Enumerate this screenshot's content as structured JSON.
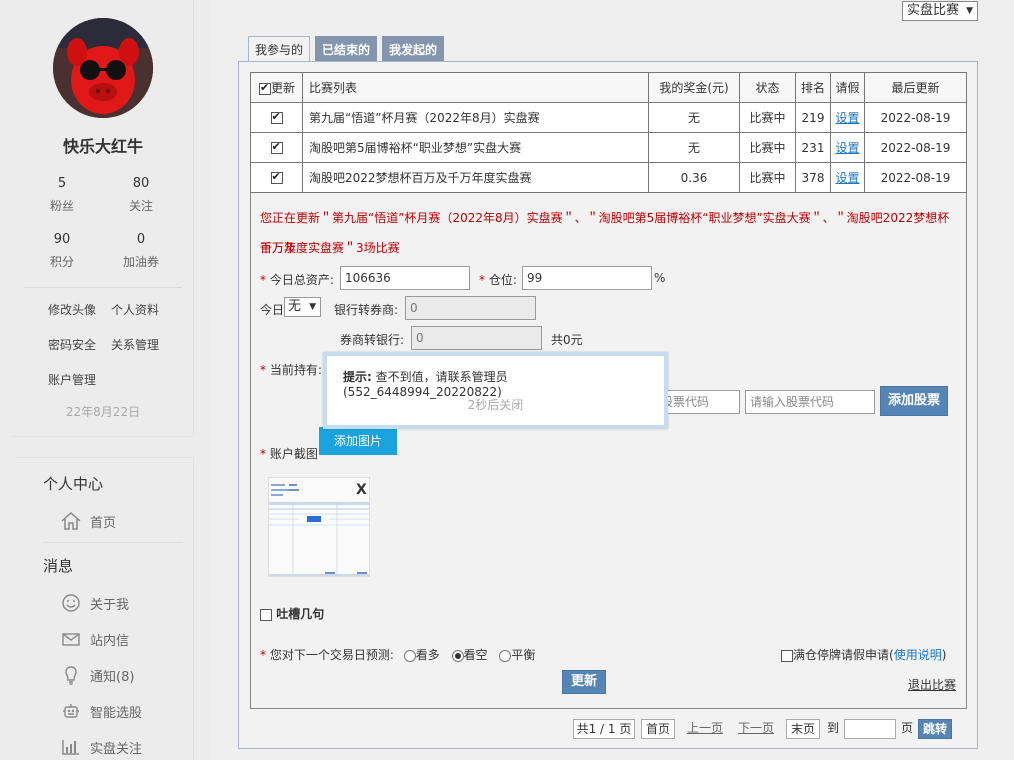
{
  "profile": {
    "username": "快乐大红牛",
    "fans_count": "5",
    "fans_label": "粉丝",
    "follow_count": "80",
    "follow_label": "关注",
    "points_count": "90",
    "points_label": "积分",
    "coupon_count": "0",
    "coupon_label": "加油券",
    "links": [
      "修改头像",
      "个人资料",
      "密码安全",
      "关系管理",
      "账户管理"
    ],
    "date": "22年8月22日"
  },
  "nav": {
    "personal_center": "个人中心",
    "home": "首页",
    "messages": "消息",
    "about_me": "关于我",
    "inbox": "站内信",
    "notifications": "通知(8)",
    "smart_pick": "智能选股",
    "live_follow": "实盘关注"
  },
  "top_select": "实盘比赛",
  "tabs": [
    "我参与的",
    "已结束的",
    "我发起的"
  ],
  "table": {
    "headers": [
      "更新",
      "比赛列表",
      "我的奖金(元)",
      "状态",
      "排名",
      "请假",
      "最后更新"
    ],
    "rows": [
      {
        "name": "第九届“悟道”杯月赛（2022年8月）实盘赛",
        "bonus": "无",
        "status": "比赛中",
        "rank": "219",
        "leave": "设置",
        "updated": "2022-08-19"
      },
      {
        "name": "淘股吧第5届博裕杯“职业梦想”实盘大赛",
        "bonus": "无",
        "status": "比赛中",
        "rank": "231",
        "leave": "设置",
        "updated": "2022-08-19"
      },
      {
        "name": "淘股吧2022梦想杯百万及千万年度实盘赛",
        "bonus": "0.36",
        "status": "比赛中",
        "rank": "378",
        "leave": "设置",
        "updated": "2022-08-19"
      }
    ]
  },
  "notice": {
    "line1": "您正在更新＂第九届“悟道”杯月赛（2022年8月）实盘赛＂、＂淘股吧第5届博裕杯“职业梦想”实盘大赛＂、＂淘股吧2022梦想杯百万及",
    "line2": "千万年度实盘赛＂3场比赛"
  },
  "form": {
    "total_assets_label": "今日总资产:",
    "total_assets_value": "106636",
    "position_label": "仓位:",
    "position_value": "99",
    "percent": "%",
    "today_label": "今日",
    "today_select": "无",
    "bank_to_broker_label": "银行转券商:",
    "bank_to_broker_value": "0",
    "broker_to_bank_label": "券商转银行:",
    "broker_to_bank_value": "0",
    "total_text": "共0元",
    "holdings_label": "当前持有:",
    "stock_code_placeholder_1": "请输入股票代码",
    "stock_code_placeholder_2": "请输入股票代码",
    "add_stock": "添加股票",
    "add_image": "添加图片",
    "screenshot_label": "账户截图",
    "remove_x": "X",
    "complain_label": "吐槽几句",
    "predict_label": "您对下一个交易日预测:",
    "opt_bull": "看多",
    "opt_bear": "看空",
    "opt_flat": "平衡",
    "leave_apply": "满仓停牌请假申请(",
    "usage": "使用说明",
    "leave_close": ")",
    "update_btn": "更新",
    "quit": "退出比赛"
  },
  "toast": {
    "title": "提示:",
    "message": "查不到值，请联系管理员(552_6448994_20220822)",
    "sub": "2秒后关闭"
  },
  "pager": {
    "info": "共1 / 1 页",
    "first": "首页",
    "prev": "上一页",
    "next": "下一页",
    "last": "末页",
    "to": "到",
    "page": "页",
    "go": "跳转"
  },
  "colors": {
    "accent": "#5584b5",
    "notice": "#c00000",
    "link": "#1a73c8",
    "cyan": "#1aa3df"
  }
}
